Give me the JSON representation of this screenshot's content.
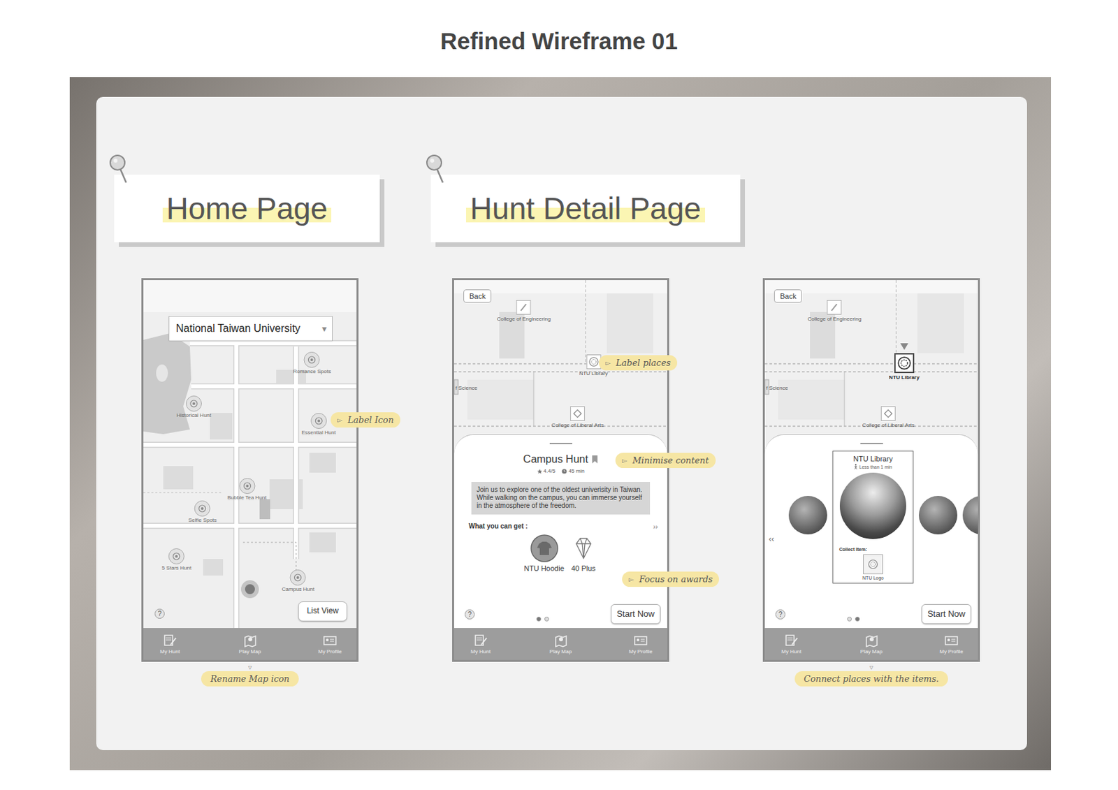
{
  "title": "Refined Wireframe 01",
  "sections": [
    {
      "label": "Home Page"
    },
    {
      "label": "Hunt Detail Page"
    }
  ],
  "tab_bar": [
    "My Hunt",
    "Play Map",
    "My Profile"
  ],
  "help": "?",
  "home": {
    "location": "National Taiwan University",
    "dropdown": "▾",
    "pins": [
      "Romance Spots",
      "Historical Hunt",
      "Essential Hunt",
      "Bubble Tea Hunt",
      "Selfie Spots",
      "5 Stars Hunt",
      "Campus Hunt"
    ],
    "list_button": "List View",
    "notes": [
      {
        "arrow": "▻",
        "text": "Label Icon"
      }
    ],
    "caption": {
      "arrow": "▿",
      "text": "Rename Map icon"
    }
  },
  "detail": {
    "back": "Back",
    "places": [
      {
        "label": "College of Engineering",
        "highlighted": false
      },
      {
        "label": "NTU Library",
        "highlighted": false
      },
      {
        "label": "f Science",
        "highlighted": false
      },
      {
        "label": "College of Liberal Arts",
        "highlighted": false
      }
    ],
    "hunt": {
      "name": "Campus Hunt",
      "rating": "4.4/5",
      "duration": "45 min",
      "description": "Join us to explore one of the oldest univerisity in Taiwan. While walking on the campus, you can immerse yourself in the atmosphere of the freedom.",
      "rewards_title": "What you can get :",
      "more": "››",
      "rewards": [
        "NTU Hoodie",
        "40 Plus"
      ]
    },
    "start": "Start Now",
    "pages": [
      {
        "selected": true
      },
      {
        "selected": false
      }
    ],
    "notes": [
      {
        "arrow": "▻",
        "text": "Label places"
      },
      {
        "arrow": "▻",
        "text": "Minimise content"
      },
      {
        "arrow": "▻",
        "text": "Focus on awards"
      }
    ]
  },
  "place": {
    "back": "Back",
    "places": [
      {
        "label": "College of Engineering",
        "highlighted": false
      },
      {
        "label": "NTU Library",
        "highlighted": true
      },
      {
        "label": "f Science",
        "highlighted": false
      },
      {
        "label": "College of Liberal Arts",
        "highlighted": false
      }
    ],
    "prev": "‹‹",
    "card": {
      "name": "NTU Library",
      "distance": "Less than 1 min",
      "collect": "Collect Item:",
      "item": "NTU Logo"
    },
    "start": "Start Now",
    "pages": [
      {
        "selected": false
      },
      {
        "selected": true
      }
    ],
    "caption": {
      "arrow": "▿",
      "text": "Connect places with the items."
    }
  }
}
